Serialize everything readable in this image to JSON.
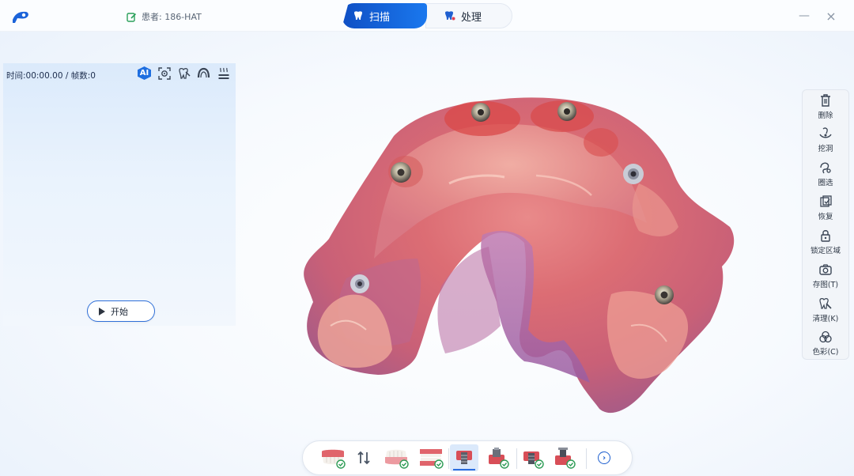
{
  "header": {
    "patient_label": "患者: 186-HAT",
    "tabs": [
      {
        "label": "扫描",
        "active": true
      },
      {
        "label": "处理",
        "active": false
      }
    ],
    "minimize_glyph": "—",
    "close_glyph": "×"
  },
  "left_panel": {
    "timeline": "时间:00:00.00 / 帧数:0",
    "ai_label": "AI",
    "tool_icons": [
      "ai-icon",
      "focus-frame-icon",
      "tooth-brush-icon",
      "arch-icon",
      "heat-icon"
    ],
    "start_label": "开始"
  },
  "right_tools": {
    "items": [
      {
        "label": "删除",
        "icon": "trash-icon"
      },
      {
        "label": "挖洞",
        "icon": "dig-hole-icon"
      },
      {
        "label": "圈选",
        "icon": "lasso-select-icon"
      },
      {
        "label": "恢复",
        "icon": "restore-icon"
      },
      {
        "label": "锁定区域",
        "icon": "lock-icon"
      },
      {
        "label": "存图(T)",
        "icon": "camera-icon"
      },
      {
        "label": "清理(K)",
        "icon": "clean-icon"
      },
      {
        "label": "色彩(C)",
        "icon": "color-icon"
      }
    ]
  },
  "bottom_tools": {
    "items": [
      "upper-jaw-icon",
      "swap-jaws-icon",
      "lower-jaw-icon",
      "bite-icon",
      "scan-body-upper-icon",
      "scan-body-lower-icon",
      "implant-upper-icon",
      "implant-lower-icon"
    ],
    "active_index": 4,
    "next_glyph": "›"
  },
  "colors": {
    "accent": "#1a6fe5",
    "tab_active_start": "#0f4fc4",
    "tab_active_end": "#1a78ee",
    "gingiva": "#d9636b",
    "panel": "#e3effc"
  }
}
